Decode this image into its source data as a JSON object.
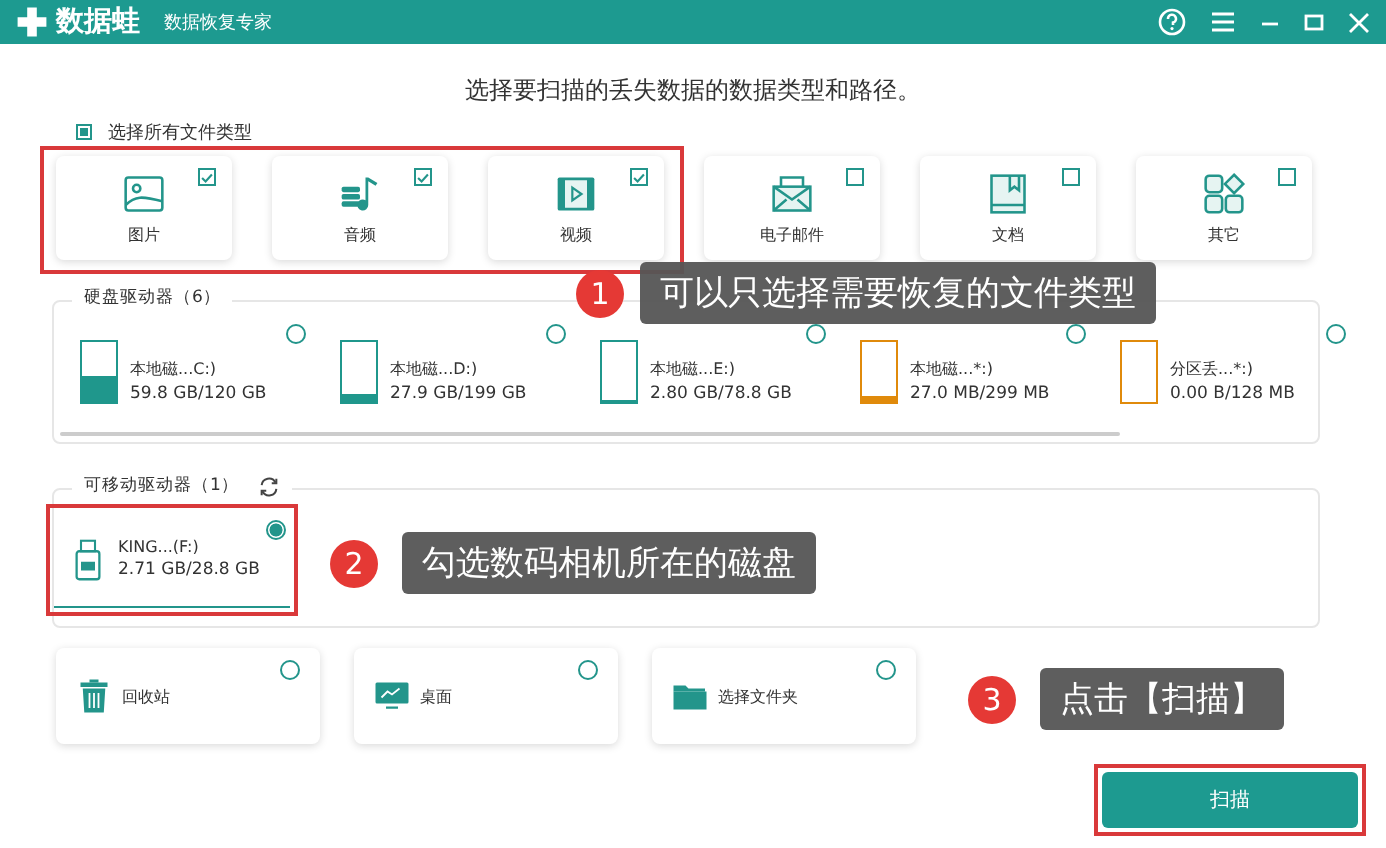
{
  "window": {
    "logo": "数据蛙",
    "subtitle": "数据恢复专家"
  },
  "heading": "选择要扫描的丢失数据的数据类型和路径。",
  "select_all": {
    "label": "选择所有文件类型",
    "checked": true
  },
  "file_types": [
    {
      "kind": "image",
      "label": "图片",
      "checked": true
    },
    {
      "kind": "audio",
      "label": "音频",
      "checked": true
    },
    {
      "kind": "video",
      "label": "视频",
      "checked": true
    },
    {
      "kind": "email",
      "label": "电子邮件",
      "checked": false
    },
    {
      "kind": "document",
      "label": "文档",
      "checked": false
    },
    {
      "kind": "other",
      "label": "其它",
      "checked": false
    }
  ],
  "hard_drives": {
    "title": "硬盘驱动器（6）",
    "items": [
      {
        "label": "本地磁...C:)",
        "size": "59.8 GB/120 GB",
        "level": 0.45,
        "color": "#1f978c",
        "selected": false
      },
      {
        "label": "本地磁...D:)",
        "size": "27.9 GB/199 GB",
        "level": 0.14,
        "color": "#1f978c",
        "selected": false
      },
      {
        "label": "本地磁...E:)",
        "size": "2.80 GB/78.8 GB",
        "level": 0.04,
        "color": "#1f978c",
        "selected": false
      },
      {
        "label": "本地磁...*:)",
        "size": "27.0 MB/299 MB",
        "level": 0.1,
        "color": "#e08a0b",
        "selected": false
      },
      {
        "label": "分区丢...*:)",
        "size": "0.00 B/128 MB",
        "level": 0,
        "color": "#e08a0b",
        "selected": false
      }
    ]
  },
  "removable": {
    "title": "可移动驱动器（1）",
    "items": [
      {
        "label": "KING...(F:)",
        "size": "2.71 GB/28.8 GB",
        "selected": true
      }
    ]
  },
  "locations": [
    {
      "kind": "trash",
      "label": "回收站",
      "selected": false
    },
    {
      "kind": "desktop",
      "label": "桌面",
      "selected": false
    },
    {
      "kind": "folder",
      "label": "选择文件夹",
      "selected": false
    }
  ],
  "scan_button": "扫描",
  "callouts": [
    {
      "number": "1",
      "text": "可以只选择需要恢复的文件类型"
    },
    {
      "number": "2",
      "text": "勾选数码相机所在的磁盘"
    },
    {
      "number": "3",
      "text": "点击【扫描】"
    }
  ]
}
